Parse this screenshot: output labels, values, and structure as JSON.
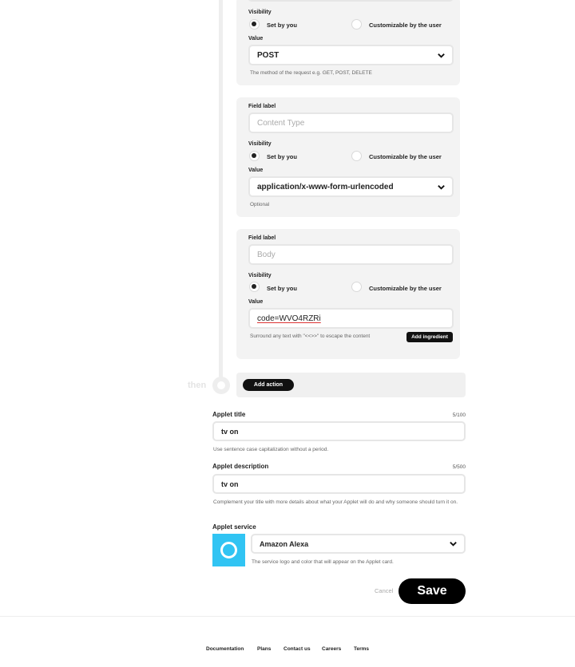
{
  "timeline": {
    "then_label": "then"
  },
  "method_card": {
    "visibility_label": "Visibility",
    "option_set": "Set by you",
    "option_custom": "Customizable by the user",
    "value_label": "Value",
    "value": "POST",
    "helper": "The method of the request e.g. GET, POST, DELETE"
  },
  "content_type_card": {
    "field_label": "Field label",
    "field_placeholder": "Content Type",
    "visibility_label": "Visibility",
    "option_set": "Set by you",
    "option_custom": "Customizable by the user",
    "value_label": "Value",
    "value": "application/x-www-form-urlencoded",
    "helper": "Optional"
  },
  "body_card": {
    "field_label": "Field label",
    "field_placeholder": "Body",
    "visibility_label": "Visibility",
    "option_set": "Set by you",
    "option_custom": "Customizable by the user",
    "value_label": "Value",
    "value": "code=WVO4RZRi",
    "helper": "Surround any text with \"<<>>\" to escape the content",
    "add_ingredient": "Add ingredient"
  },
  "add_action": {
    "label": "Add action"
  },
  "applet_title": {
    "label": "Applet title",
    "counter": "5/100",
    "value": "tv on",
    "helper": "Use sentence case capitalization without a period."
  },
  "applet_description": {
    "label": "Applet description",
    "counter": "5/500",
    "value": "tv on",
    "helper": "Complement your title with more details about what your Applet will do and why someone should turn it on."
  },
  "applet_service": {
    "label": "Applet service",
    "value": "Amazon Alexa",
    "helper": "The service logo and color that will appear on the Applet card.",
    "logo_color": "#31c4f3"
  },
  "actions": {
    "cancel": "Cancel",
    "save": "Save"
  },
  "footer": {
    "links": [
      "Documentation",
      "Plans",
      "Contact us",
      "Careers",
      "Terms"
    ]
  }
}
